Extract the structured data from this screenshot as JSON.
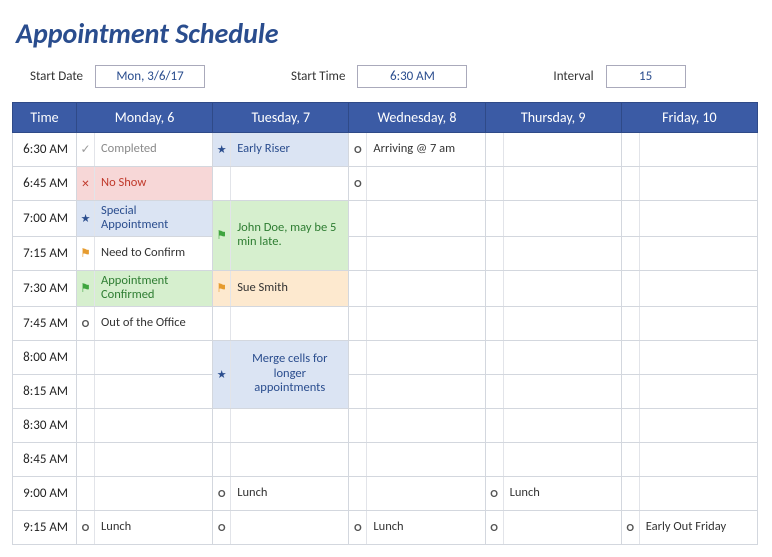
{
  "title": "Appointment Schedule",
  "controls": {
    "start_date_label": "Start Date",
    "start_date_value": "Mon, 3/6/17",
    "start_time_label": "Start Time",
    "start_time_value": "6:30 AM",
    "interval_label": "Interval",
    "interval_value": "15"
  },
  "headers": [
    "Time",
    "Monday, 6",
    "Tuesday, 7",
    "Wednesday, 8",
    "Thursday, 9",
    "Friday, 10"
  ],
  "times": [
    "6:30 AM",
    "6:45 AM",
    "7:00 AM",
    "7:15 AM",
    "7:30 AM",
    "7:45 AM",
    "8:00 AM",
    "8:15 AM",
    "8:30 AM",
    "8:45 AM",
    "9:00 AM",
    "9:15 AM"
  ],
  "cells": {
    "completed": "Completed",
    "early_riser": "Early Riser",
    "arriving": "Arriving @ 7 am",
    "no_show": "No Show",
    "special": "Special Appointment",
    "john": "John Doe, may be 5 min late.",
    "need_confirm": "Need to Confirm",
    "appt_conf": "Appointment Confirmed",
    "sue": "Sue Smith",
    "out_office": "Out of the Office",
    "merge": "Merge cells for longer appointments",
    "lunch": "Lunch",
    "early_out": "Early Out Friday"
  }
}
